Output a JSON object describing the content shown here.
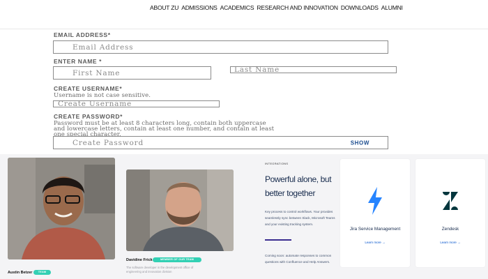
{
  "nav": {
    "items": [
      "ABOUT ZU",
      "ADMISSIONS",
      "ACADEMICS",
      "RESEARCH AND INNOVATION",
      "DOWNLOADS",
      "ALUMNI"
    ]
  },
  "form": {
    "email": {
      "label": "EMAIL ADDRESS*",
      "placeholder": "Email Address",
      "value": ""
    },
    "name": {
      "label": "ENTER NAME *",
      "first_placeholder": "First Name",
      "last_placeholder": "Last Name"
    },
    "username": {
      "label": "CREATE USERNAME*",
      "hint": "Username is not case sensitive.",
      "placeholder": "Create Username"
    },
    "password": {
      "label": "CREATE PASSWORD*",
      "hint_lines": [
        "Password must be at least 8 characters long, contain both uppercase",
        "and lowercase letters, contain at least one number, and contain at least",
        "one special character."
      ],
      "placeholder": "Create Password",
      "show_label": "SHOW"
    }
  },
  "banner": {
    "people": [
      {
        "name": "Austin Betzer",
        "badge": "TEAM"
      },
      {
        "name": "Davidine Frick",
        "badge": "MEMBER OF OUR TEAM",
        "caption_lines": [
          "The software developer in the development office of",
          "engineering and innovation division"
        ]
      }
    ],
    "promo": {
      "eyebrow": "INTEGRATIONS",
      "title": "Powerful alone, but better together",
      "description": "Key process to control workflows. Your provides seamlessly sync between Slack, Microsoft Teams and your existing tracking system.",
      "footer": "Coming soon: automate responses to common questions with Confluence and Help Answers."
    },
    "cards": [
      {
        "name": "Jira Service Management",
        "link": "Learn more →",
        "icon": "bolt-icon",
        "color": "#2684ff"
      },
      {
        "name": "Zendesk",
        "link": "Learn more →",
        "icon": "zendesk-logo-icon",
        "color": "#03363d"
      }
    ]
  }
}
